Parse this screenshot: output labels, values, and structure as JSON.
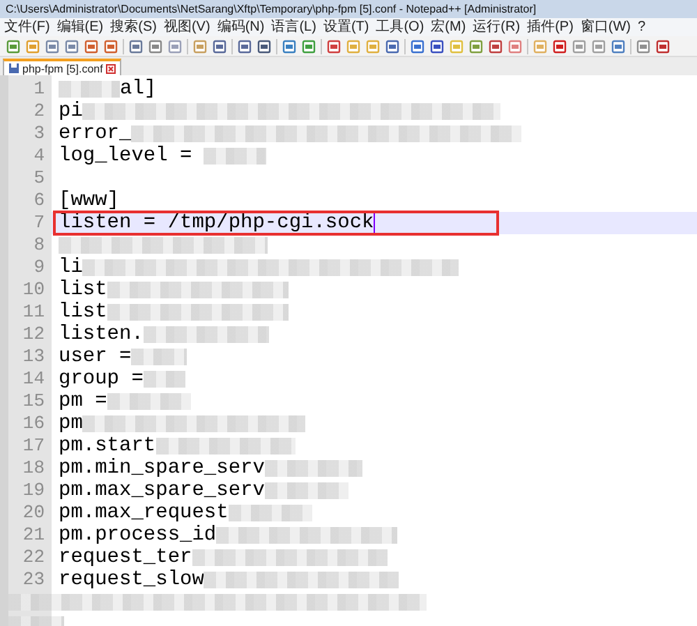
{
  "window": {
    "title": "C:\\Users\\Administrator\\Documents\\NetSarang\\Xftp\\Temporary\\php-fpm [5].conf - Notepad++ [Administrator]"
  },
  "menu": [
    "文件(F)",
    "编辑(E)",
    "搜索(S)",
    "视图(V)",
    "编码(N)",
    "语言(L)",
    "设置(T)",
    "工具(O)",
    "宏(M)",
    "运行(R)",
    "插件(P)",
    "窗口(W)",
    "?"
  ],
  "tabs": [
    {
      "label": "php-fpm [5].conf",
      "selected": true
    }
  ],
  "lines": [
    {
      "number": "1",
      "text": "al]",
      "current": false,
      "boxed": false
    },
    {
      "number": "2",
      "text": "pi",
      "current": false,
      "boxed": false
    },
    {
      "number": "3",
      "text": "error_",
      "current": false,
      "boxed": false
    },
    {
      "number": "4",
      "text": "log_level = ",
      "current": false,
      "boxed": false
    },
    {
      "number": "5",
      "current": false,
      "boxed": false
    },
    {
      "number": "6",
      "text": "[www]",
      "current": false,
      "boxed": false
    },
    {
      "number": "7",
      "text": "listen = /tmp/php-cgi.sock",
      "current": true,
      "boxed": true
    },
    {
      "number": "8",
      "current": false,
      "boxed": false
    },
    {
      "number": "9",
      "text": "li",
      "current": false,
      "boxed": false
    },
    {
      "number": "10",
      "text": "list",
      "current": false,
      "boxed": false
    },
    {
      "number": "11",
      "text": "list",
      "current": false,
      "boxed": false
    },
    {
      "number": "12",
      "text": "listen.",
      "current": false,
      "boxed": false
    },
    {
      "number": "13",
      "text": "user =",
      "current": false,
      "boxed": false
    },
    {
      "number": "14",
      "text": "group =",
      "current": false,
      "boxed": false
    },
    {
      "number": "15",
      "text": "pm =",
      "current": false,
      "boxed": false
    },
    {
      "number": "16",
      "text": "pm",
      "current": false,
      "boxed": false
    },
    {
      "number": "17",
      "text": "pm.start",
      "current": false,
      "boxed": false
    },
    {
      "number": "18",
      "text": "pm.min_spare_serv",
      "current": false,
      "boxed": false
    },
    {
      "number": "19",
      "text": "pm.max_spare_serv",
      "current": false,
      "boxed": false
    },
    {
      "number": "20",
      "text": "pm.max_request",
      "current": false,
      "boxed": false
    },
    {
      "number": "21",
      "text": "pm.process_id",
      "current": false,
      "boxed": false
    },
    {
      "number": "22",
      "text": "request_ter",
      "current": false,
      "boxed": false
    },
    {
      "number": "23",
      "text": "request_slow",
      "current": false,
      "boxed": false
    }
  ]
}
